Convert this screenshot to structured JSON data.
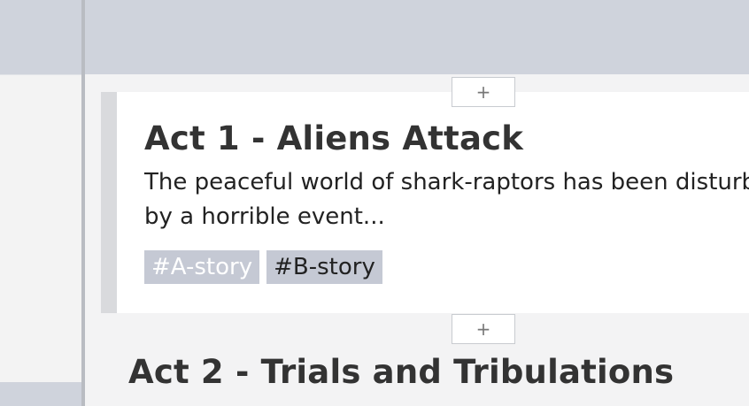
{
  "acts": [
    {
      "title": "Act 1 - Aliens Attack",
      "description": "The peaceful world of shark-raptors has been disturbed by a horrible event...",
      "tags": [
        "#A-story",
        "#B-story"
      ]
    },
    {
      "title": "Act 2 - Trials and Tribulations"
    }
  ],
  "add_button_label": "+",
  "icons": {
    "add": "plus-icon"
  },
  "colors": {
    "frame": "#cfd3dc",
    "tag_background": "#c5c9d4",
    "active_card_border": "#d9dadd"
  }
}
